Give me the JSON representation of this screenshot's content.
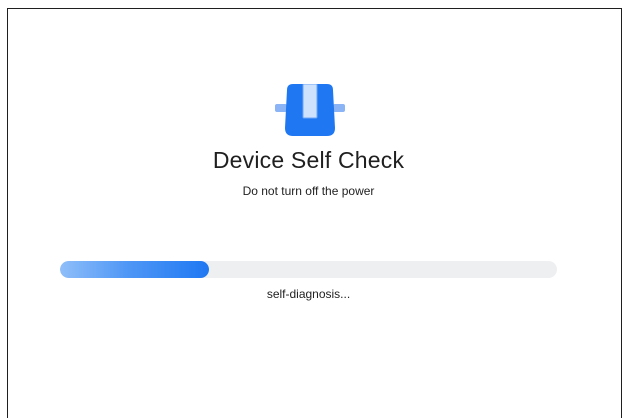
{
  "dialog": {
    "icon": "device-box-icon",
    "title": "Device Self Check",
    "subtitle": "Do not turn off the power",
    "progress": {
      "fraction": 0.3,
      "status_text": "self-diagnosis..."
    }
  },
  "colors": {
    "accent": "#1f78f2",
    "accent_light": "#8fbef9",
    "track": "#eeeff1",
    "text": "#202020"
  }
}
